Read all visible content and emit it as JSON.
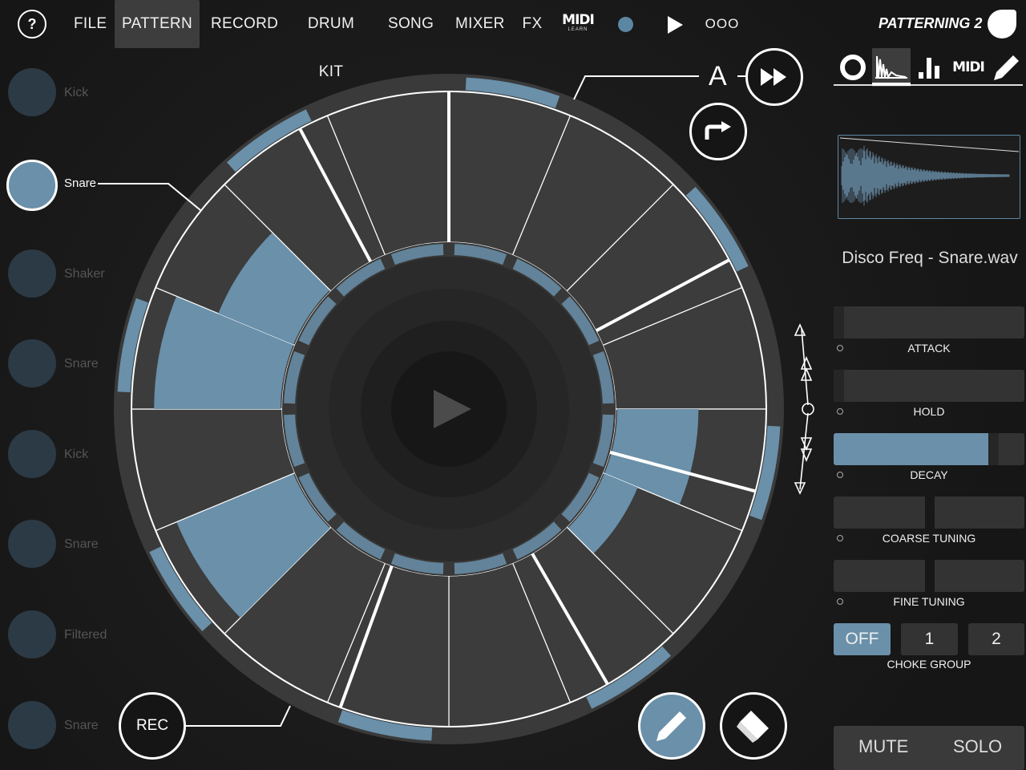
{
  "topbar": {
    "help_label": "?",
    "menu": [
      {
        "label": "FILE"
      },
      {
        "label": "PATTERN",
        "active": true
      },
      {
        "label": "RECORD"
      },
      {
        "label": "DRUM KIT"
      },
      {
        "label": "SONG"
      },
      {
        "label": "MIXER"
      },
      {
        "label": "FX"
      }
    ],
    "midi_learn_big": "MIDI",
    "midi_learn_small": "LEARN",
    "tempo_menu": "OOO",
    "brand": "PATTERNING 2",
    "record_color": "#5c87a3"
  },
  "tracks": [
    {
      "label": "Kick"
    },
    {
      "label": "Snare",
      "selected": true
    },
    {
      "label": "Shaker"
    },
    {
      "label": "Snare"
    },
    {
      "label": "Kick"
    },
    {
      "label": "Snare"
    },
    {
      "label": "Filtered"
    },
    {
      "label": "Snare"
    }
  ],
  "sequencer": {
    "pattern_letter": "A",
    "steps": 16,
    "active_step_levels": [
      0,
      0,
      0,
      0,
      0.55,
      0.25,
      0,
      0,
      0,
      0,
      0.85,
      0,
      0.85,
      0.55,
      0,
      0
    ],
    "step_color": "#6a90aa",
    "icons": [
      "play-icon",
      "fast-forward-icon",
      "redo-arrow-icon",
      "pencil-icon",
      "eraser-icon"
    ]
  },
  "transport": {
    "rec_label": "REC"
  },
  "panel": {
    "tabs": [
      "circle-icon",
      "waveform-icon",
      "bars-icon",
      "midi-icon",
      "pencil-icon"
    ],
    "sample_name": "Disco Freq - Snare.wav",
    "params": [
      {
        "label": "ATTACK",
        "value": 0.0
      },
      {
        "label": "HOLD",
        "value": 0.0
      },
      {
        "label": "DECAY",
        "value": 0.81
      },
      {
        "label": "COARSE TUNING",
        "value": 0.5
      },
      {
        "label": "FINE TUNING",
        "value": 0.5
      }
    ],
    "choke": {
      "label": "CHOKE GROUP",
      "options": [
        "OFF",
        "1",
        "2"
      ],
      "selected": "OFF"
    },
    "mute_label": "MUTE",
    "solo_label": "SOLO"
  }
}
